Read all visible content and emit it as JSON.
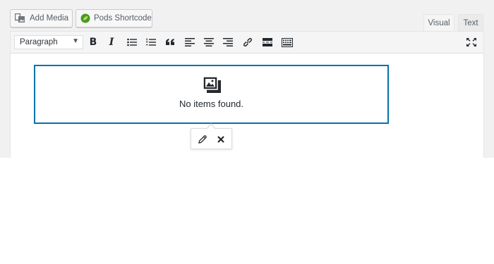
{
  "media_buttons": {
    "add_media": {
      "label": "Add Media",
      "icon": "media-icon"
    },
    "pods_shortcode": {
      "label": "Pods Shortcode",
      "icon": "pods-logo-icon"
    }
  },
  "tabs": {
    "visual": "Visual",
    "text": "Text",
    "active": "visual"
  },
  "toolbar": {
    "format_select": {
      "selected": "Paragraph"
    },
    "buttons": [
      {
        "name": "bold",
        "glyph": "B",
        "icon": "bold-icon"
      },
      {
        "name": "italic",
        "glyph": "I",
        "icon": "italic-icon"
      },
      {
        "name": "bullet-list",
        "icon": "bullet-list-icon"
      },
      {
        "name": "numbered-list",
        "icon": "numbered-list-icon"
      },
      {
        "name": "blockquote",
        "icon": "blockquote-icon"
      },
      {
        "name": "align-left",
        "icon": "align-left-icon"
      },
      {
        "name": "align-center",
        "icon": "align-center-icon"
      },
      {
        "name": "align-right",
        "icon": "align-right-icon"
      },
      {
        "name": "insert-link",
        "icon": "link-icon"
      },
      {
        "name": "read-more",
        "icon": "read-more-icon"
      },
      {
        "name": "toolbar-toggle",
        "icon": "keyboard-icon"
      },
      {
        "name": "fullscreen",
        "icon": "fullscreen-icon"
      }
    ]
  },
  "content": {
    "gallery_message": "No items found.",
    "gallery_icon": "gallery-icon"
  },
  "inline_toolbar": {
    "edit_icon": "pencil-icon",
    "remove_icon": "close-icon"
  },
  "colors": {
    "accent": "#0073aa",
    "pods_green": "#4a9a1e"
  }
}
